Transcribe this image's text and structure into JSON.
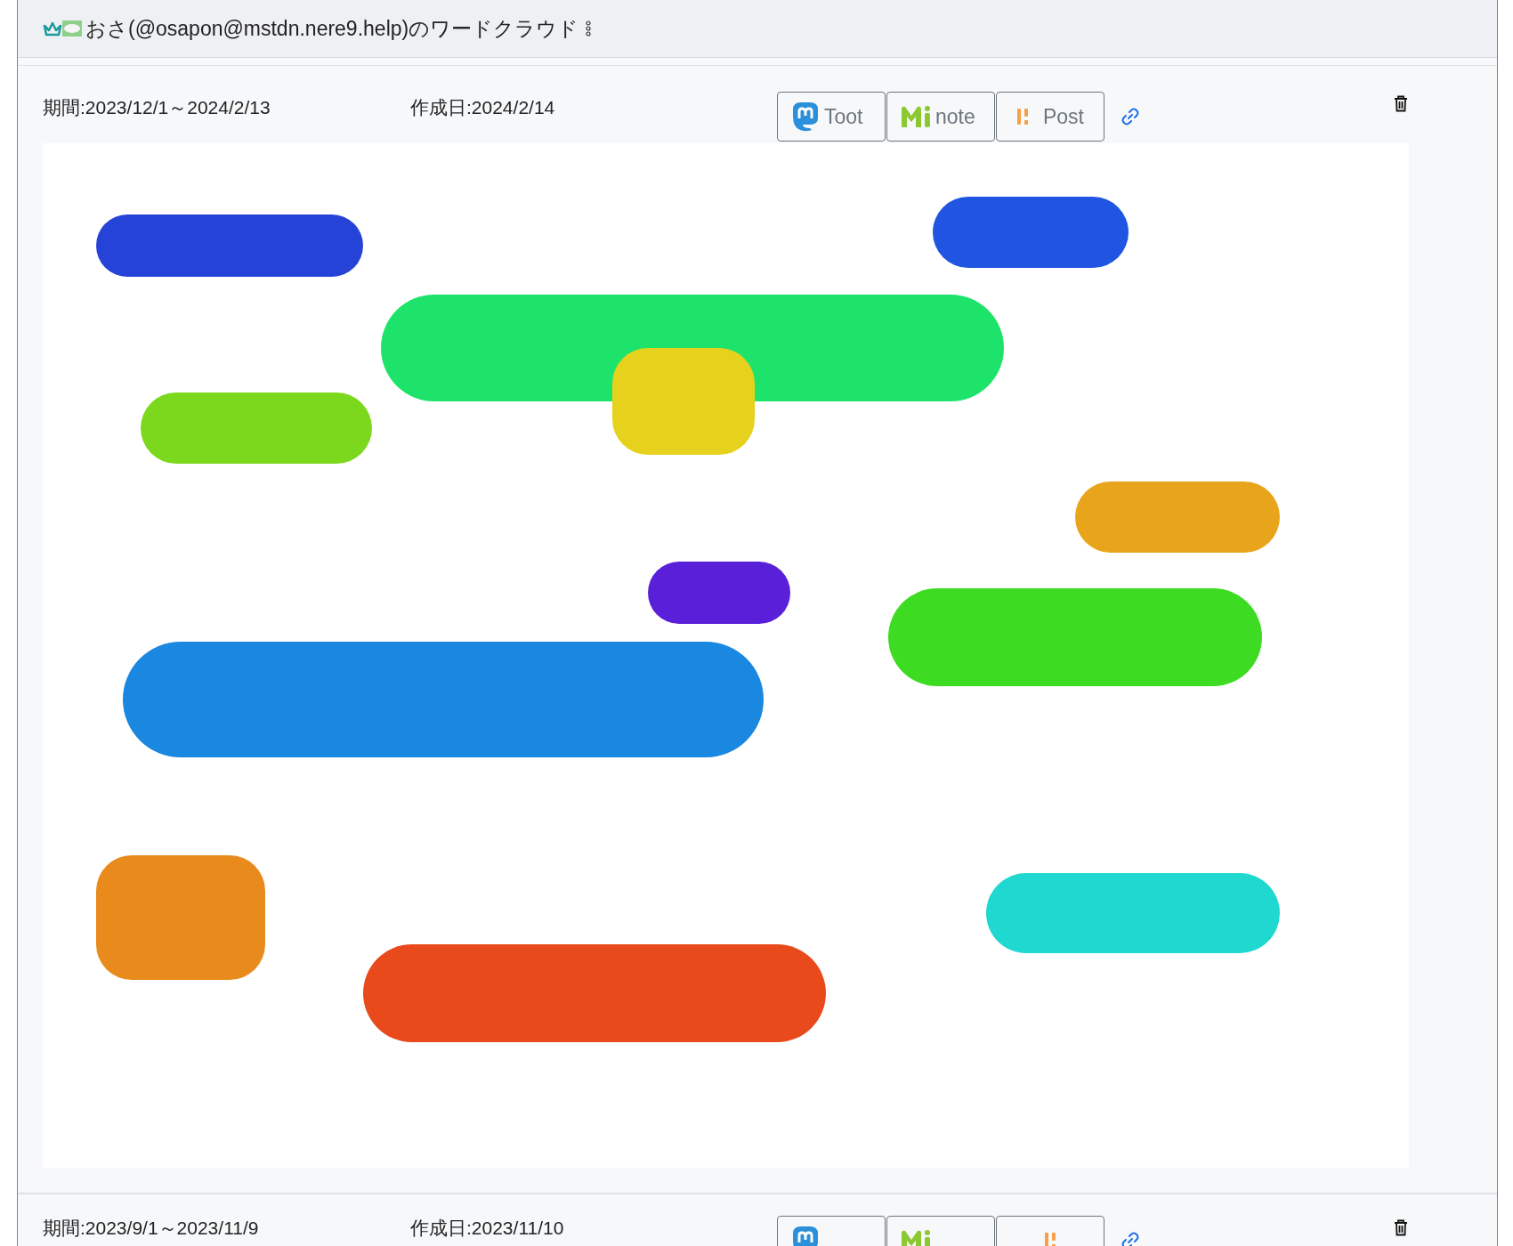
{
  "header": {
    "title": "おさ(@osapon@mstdn.nere9.help)のワードクラウド"
  },
  "clouds": [
    {
      "period": "期間:2023/12/1～2024/2/13",
      "created": "作成日:2024/2/14",
      "buttons": [
        {
          "kind": "mastodon",
          "label": "Toot"
        },
        {
          "kind": "misskey",
          "label": "note"
        },
        {
          "kind": "post",
          "label": "Post"
        }
      ]
    },
    {
      "period": "期間:2023/9/1～2023/11/9",
      "created": "作成日:2023/11/10",
      "buttons": [
        {
          "kind": "mastodon"
        },
        {
          "kind": "misskey"
        },
        {
          "kind": "post"
        }
      ]
    }
  ]
}
